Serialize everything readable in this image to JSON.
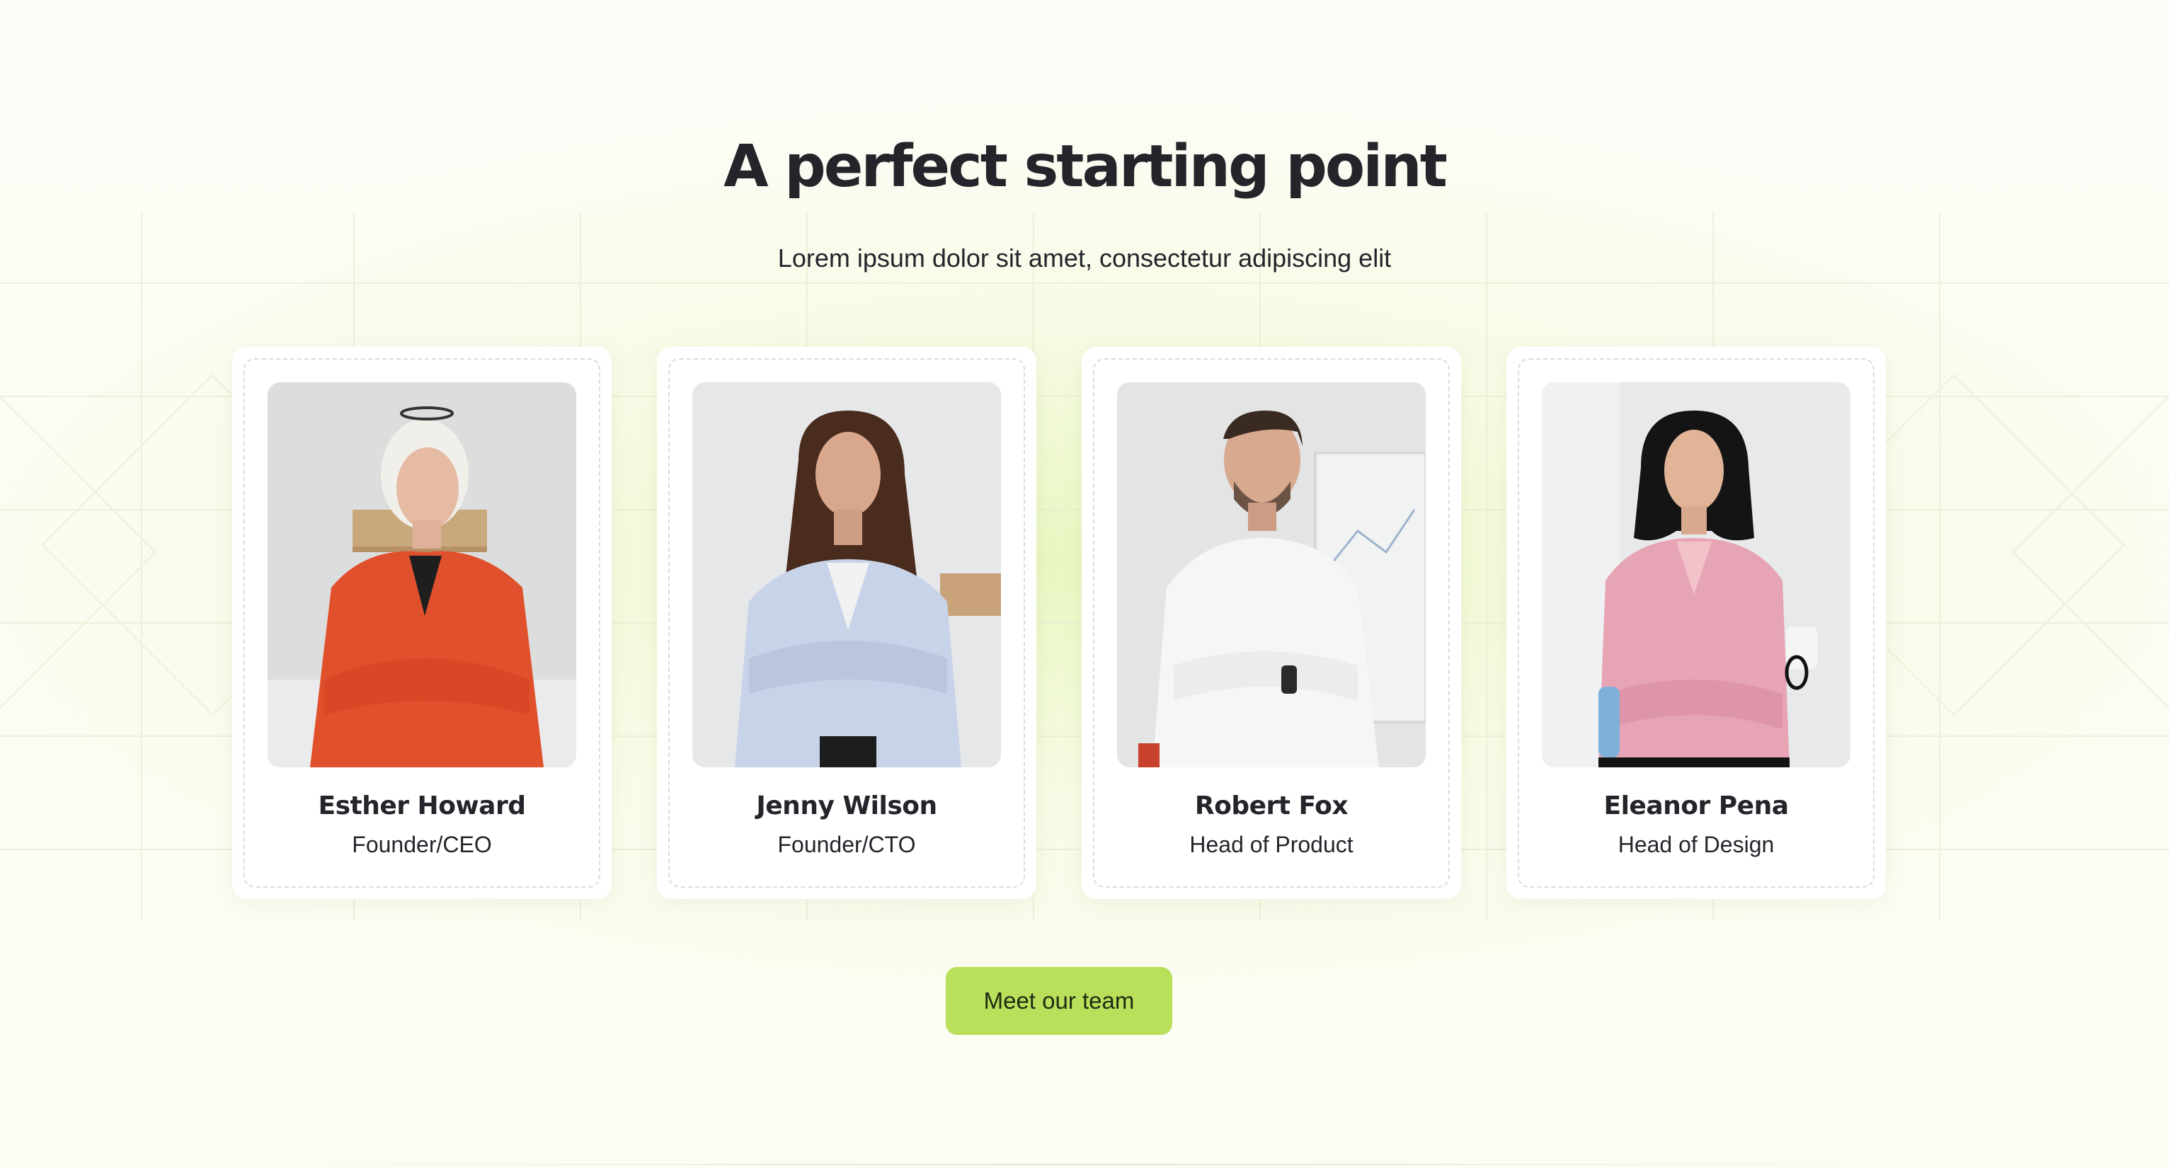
{
  "section": {
    "title": "A perfect starting point",
    "subtitle": "Lorem ipsum dolor sit amet, consectetur adipiscing elit"
  },
  "team": [
    {
      "name": "Esther Howard",
      "role": "Founder/CEO",
      "photo": "portrait-older-woman-red-blazer"
    },
    {
      "name": "Jenny Wilson",
      "role": "Founder/CTO",
      "photo": "portrait-woman-light-blue-blazer"
    },
    {
      "name": "Robert Fox",
      "role": "Head of Product",
      "photo": "portrait-man-white-shirt"
    },
    {
      "name": "Eleanor Pena",
      "role": "Head of Design",
      "photo": "portrait-woman-pink-shirt"
    }
  ],
  "cta": {
    "label": "Meet our team"
  },
  "colors": {
    "accent": "#b9e05a",
    "text": "#23252b",
    "card": "#ffffff",
    "background": "#f6fbe4"
  }
}
